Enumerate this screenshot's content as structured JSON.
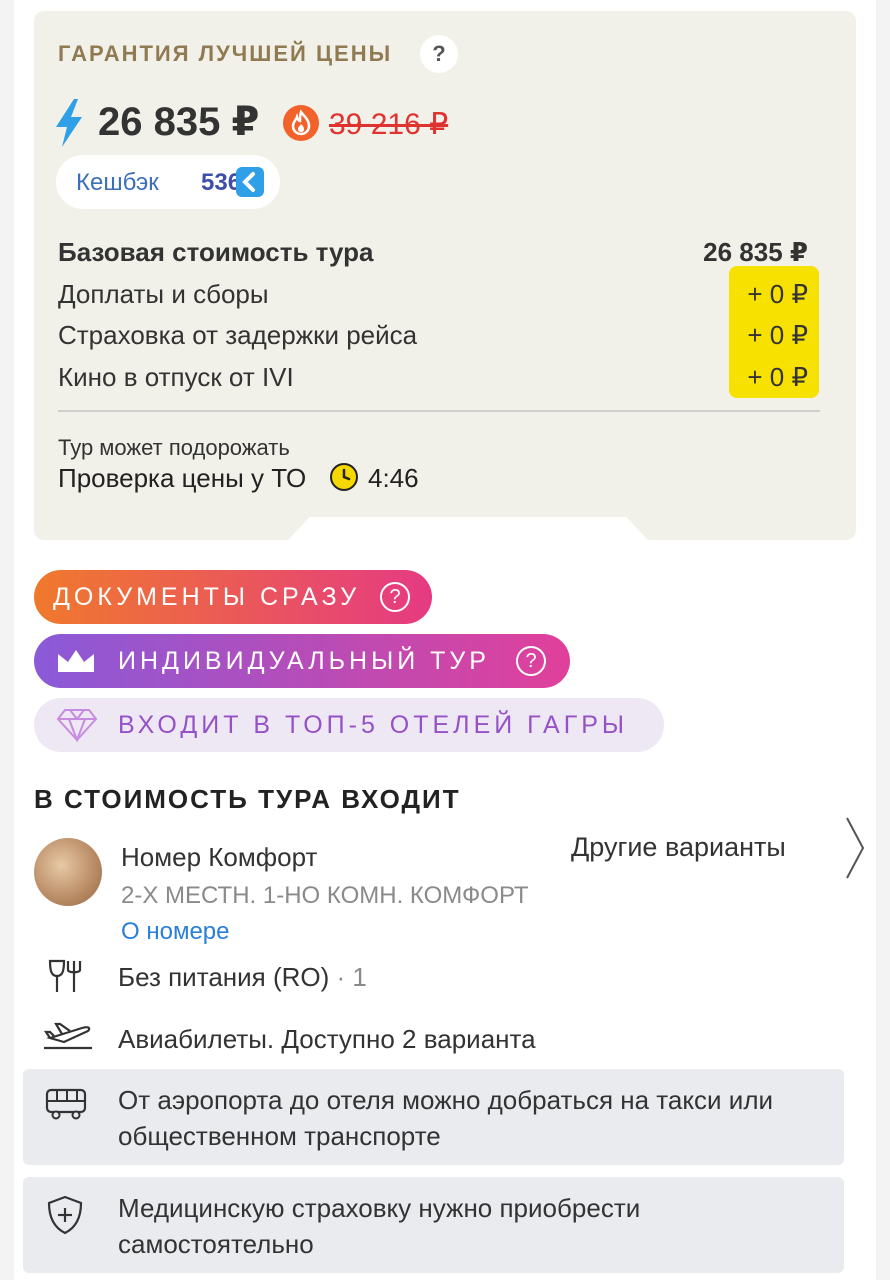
{
  "guarantee": {
    "title": "ГАРАНТИЯ ЛУЧШЕЙ ЦЕНЫ",
    "help": "?"
  },
  "price": {
    "current": "26 835 ₽",
    "old": "39 216 ₽"
  },
  "cashback": {
    "label": "Кешбэк",
    "amount": "536"
  },
  "breakdown": [
    {
      "label": "Базовая стоимость тура",
      "value": "26 835 ₽"
    },
    {
      "label": "Доплаты и сборы",
      "value": "+ 0 ₽"
    },
    {
      "label": "Страховка от задержки рейса",
      "value": "+ 0 ₽"
    },
    {
      "label": "Кино в отпуск от IVI",
      "value": "+ 0 ₽"
    }
  ],
  "price_check": {
    "note": "Тур может подорожать",
    "label": "Проверка цены у ТО",
    "timer": "4:46"
  },
  "badges": [
    {
      "text": "ДОКУМЕНТЫ СРАЗУ",
      "help": "?"
    },
    {
      "text": "ИНДИВИДУАЛЬНЫЙ ТУР",
      "help": "?"
    },
    {
      "text": "ВХОДИТ В ТОП-5 ОТЕЛЕЙ ГАГРЫ"
    }
  ],
  "included": {
    "title": "В СТОИМОСТЬ ТУРА ВХОДИТ",
    "room": {
      "name": "Номер Комфорт",
      "type": "2-Х МЕСТН. 1-НО КОМН. КОМФОРТ",
      "link": "О номере",
      "other": "Другие варианты"
    },
    "meal": {
      "text": "Без питания (RO)",
      "count": "· 1"
    },
    "flights": "Авиабилеты. Доступно 2 варианта",
    "transfer": "От аэропорта до отеля можно добраться на такси или общественном транспорте",
    "insurance": "Медицинскую страховку нужно приобрести самостоятельно"
  },
  "colors": {
    "guarantee": "#8f7a52",
    "old_price": "#e0322f",
    "highlight": "#f7e100",
    "link": "#2a7fd8",
    "cashback": "#3d6fb8"
  },
  "icons": [
    "lightning-icon",
    "fire-icon",
    "cashback-icon",
    "clock-icon",
    "crown-icon",
    "diamond-icon",
    "chevron-right-icon",
    "cutlery-icon",
    "plane-icon",
    "bus-icon",
    "shield-icon"
  ]
}
